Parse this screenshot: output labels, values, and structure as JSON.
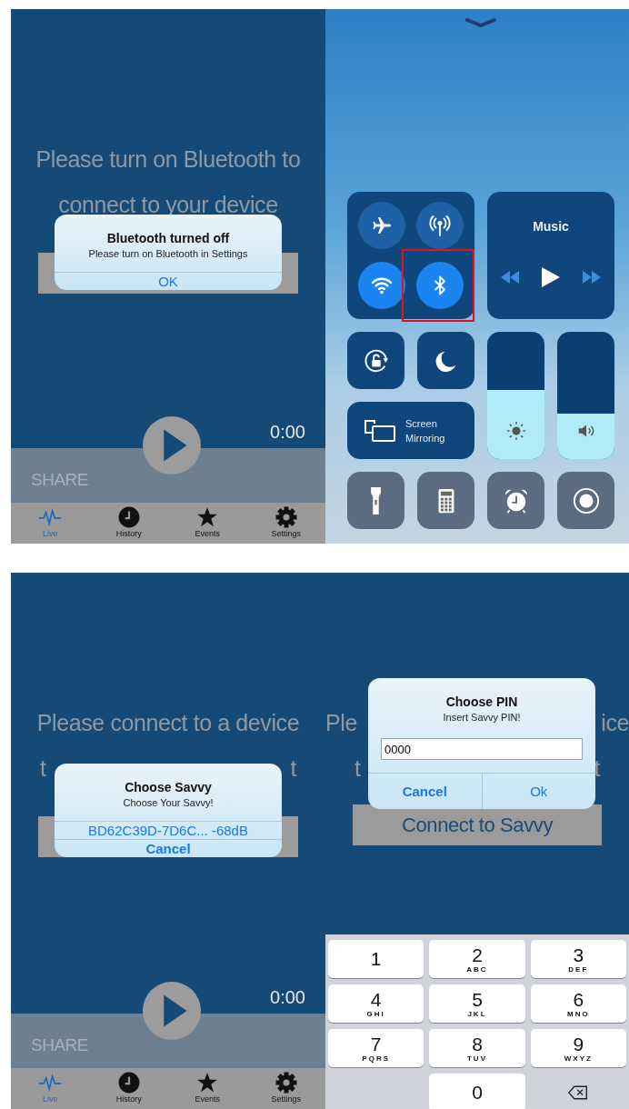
{
  "screens": [
    {
      "kind": "app",
      "heading": [
        {
          "parts": [
            "Please turn on Bluetooth to"
          ]
        },
        {
          "parts": [
            "connect to your device"
          ]
        }
      ],
      "player": {
        "time": "0:00",
        "share": "SHARE"
      },
      "tabs": [
        {
          "label": "Live",
          "selected": true
        },
        {
          "label": "History",
          "selected": false
        },
        {
          "label": "Events",
          "selected": false
        },
        {
          "label": "Settings",
          "selected": false
        }
      ],
      "dialog": {
        "title": "Bluetooth turned off",
        "message": "Please turn on Bluetooth in Settings",
        "buttons": [
          {
            "label": "OK",
            "bold": false
          }
        ]
      }
    },
    {
      "kind": "control_center",
      "toggles": [
        {
          "on": false
        },
        {
          "on": false
        },
        {
          "on": true
        },
        {
          "on": true,
          "highlighted": true
        }
      ],
      "music": {
        "title": "Music"
      },
      "sliders": [
        {
          "level": 0.54
        },
        {
          "level": 0.36
        }
      ],
      "mirroring": "Screen Mirroring"
    },
    {
      "kind": "app",
      "heading": [
        {
          "parts": [
            "Please connect to a device"
          ]
        },
        {
          "parts": [
            "t",
            "t"
          ]
        }
      ],
      "player": {
        "time": "0:00",
        "share": "SHARE"
      },
      "tabs": [
        {
          "label": "Live",
          "selected": true
        },
        {
          "label": "History",
          "selected": false
        },
        {
          "label": "Events",
          "selected": false
        },
        {
          "label": "Settings",
          "selected": false
        }
      ],
      "dialog": {
        "title": "Choose Savvy",
        "message": "Choose Your Savvy!",
        "buttons": [
          {
            "label": "BD62C39D-7D6C... -68dB",
            "bold": false
          },
          {
            "label": "Cancel",
            "bold": true
          }
        ]
      }
    },
    {
      "kind": "app",
      "heading": [
        {
          "parts": [
            "Ple",
            "ice"
          ]
        },
        {
          "parts": [
            "t",
            "t"
          ]
        }
      ],
      "connect_label": "Connect to Savvy",
      "dialog": {
        "title": "Choose PIN",
        "message": "Insert Savvy PIN!",
        "input": {
          "value": "0000"
        },
        "buttons": [
          {
            "label": "Cancel",
            "bold": true
          },
          {
            "label": "Ok",
            "bold": false
          }
        ]
      },
      "keyboard": [
        {
          "kind": "digit",
          "digit": "1"
        },
        {
          "kind": "digit",
          "digit": "2",
          "letters": "ABC"
        },
        {
          "kind": "digit",
          "digit": "3",
          "letters": "DEF"
        },
        {
          "kind": "digit",
          "digit": "4",
          "letters": "GHI"
        },
        {
          "kind": "digit",
          "digit": "5",
          "letters": "JKL"
        },
        {
          "kind": "digit",
          "digit": "6",
          "letters": "MNO"
        },
        {
          "kind": "digit",
          "digit": "7",
          "letters": "PQRS"
        },
        {
          "kind": "digit",
          "digit": "8",
          "letters": "TUV"
        },
        {
          "kind": "digit",
          "digit": "9",
          "letters": "WXYZ"
        },
        {
          "kind": "blank"
        },
        {
          "kind": "digit",
          "digit": "0"
        },
        {
          "kind": "backspace"
        }
      ]
    }
  ]
}
